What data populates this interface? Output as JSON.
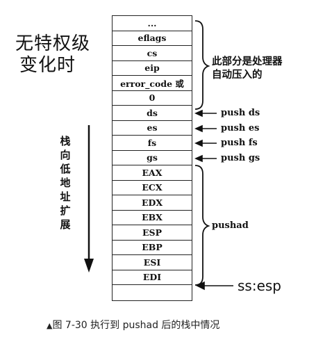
{
  "title": [
    "无特权级",
    "变化时"
  ],
  "stack_cells": [
    "...",
    "eflags",
    "cs",
    "eip",
    "error_code 或",
    "0",
    "ds",
    "es",
    "fs",
    "gs",
    "EAX",
    "ECX",
    "EDX",
    "EBX",
    "ESP",
    "EBP",
    "ESI",
    "EDI",
    ""
  ],
  "cpu_auto_note": [
    "此部分是处理器",
    "自动压入的"
  ],
  "push_labels": [
    "push ds",
    "push es",
    "push fs",
    "push gs"
  ],
  "pushad_label": "pushad",
  "ss_esp_label": "ss:esp",
  "direction_label": [
    "栈",
    "向",
    "低",
    "地",
    "址",
    "扩",
    "展"
  ],
  "caption": {
    "marker": "▲",
    "text": "图 7-30   执行到 pushad 后的栈中情况"
  }
}
